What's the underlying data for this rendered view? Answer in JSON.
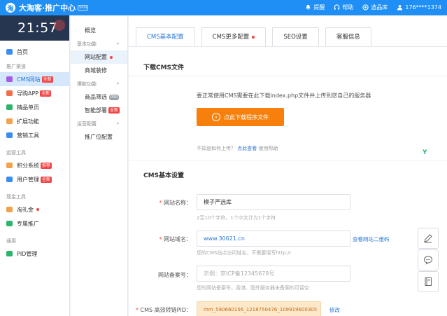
{
  "header": {
    "title": "大淘客·推广中心",
    "badge": "beta",
    "actions": [
      {
        "label": "提醒",
        "icon": "bell-icon"
      },
      {
        "label": "帮助",
        "icon": "headset-icon"
      },
      {
        "label": "选品库",
        "icon": "shop-icon"
      },
      {
        "label": "176****1374",
        "icon": "user-icon"
      }
    ]
  },
  "sidebar": {
    "clock": "21:57",
    "home": {
      "label": "首页"
    },
    "section_promo": "推广渠道",
    "cms": {
      "label": "CMS网站",
      "tag": "全新"
    },
    "guide_app": {
      "label": "导购APP",
      "tag": "全新"
    },
    "single": {
      "label": "精品单页"
    },
    "extend": {
      "label": "扩展功能"
    },
    "marketing": {
      "label": "营销工具"
    },
    "section_ops": "运营工具",
    "points": {
      "label": "积分系统",
      "tag": "推荐"
    },
    "users": {
      "label": "用户管理",
      "tag": "全新"
    },
    "section_cash": "现金工具",
    "gift": {
      "label": "淘礼金"
    },
    "special": {
      "label": "专属推广"
    },
    "section_general": "通用",
    "pid": {
      "label": "PID管理"
    }
  },
  "submenu": {
    "overview": "概览",
    "group_basic": "基本功能",
    "site_config": "网站配置",
    "mall_decor": "商城装修",
    "group_hot": "爆款功能",
    "product_filter": "商品筛选",
    "product_filter_tag": "PRO",
    "smart_deploy": "智能部署",
    "smart_deploy_tag": "全新",
    "group_ops": "运营配置",
    "ad_config": "推广位配置"
  },
  "tabs": [
    {
      "label": "CMS基本配置",
      "active": true,
      "dot": false
    },
    {
      "label": "CMS更多配置",
      "active": false,
      "dot": true
    },
    {
      "label": "SEO设置",
      "active": false,
      "dot": false
    },
    {
      "label": "客服信息",
      "active": false,
      "dot": false
    }
  ],
  "download": {
    "section_title": "下载CMS文件",
    "notice": "要正常使用CMS需要在此下载index.php文件并上传到您自己的服务器",
    "button_label": "点此下载程序文件",
    "help_prefix": "不知道如何上传？",
    "help_link": "点此查看",
    "help_suffix": "使用帮助"
  },
  "basic": {
    "section_title": "CMS基本设置",
    "site_name": {
      "label": "网站名称：",
      "value": "模子严选库",
      "hint": "2至10个字符，1个中文计为1个字符"
    },
    "site_domain": {
      "label": "网站域名：",
      "value": "www.30621.cn",
      "hint": "您的CMS站点访问域名，不需要填写http://",
      "link": "查看网站二维码"
    },
    "site_icp": {
      "label": "网站备案号：",
      "placeholder": "示例：京ICP备12345678号",
      "hint": "您的网站备案号，香港、国外服务器未备案的可留空"
    },
    "pid": {
      "label": "CMS 高效转链PID：",
      "value": "mm_590660156_1218750476_109919600305",
      "link": "修改"
    }
  },
  "colors": {
    "primary": "#1f8ef5",
    "accent_orange": "#f7800c",
    "danger": "#f24545",
    "sidebar_active": "#d4e7fb"
  }
}
